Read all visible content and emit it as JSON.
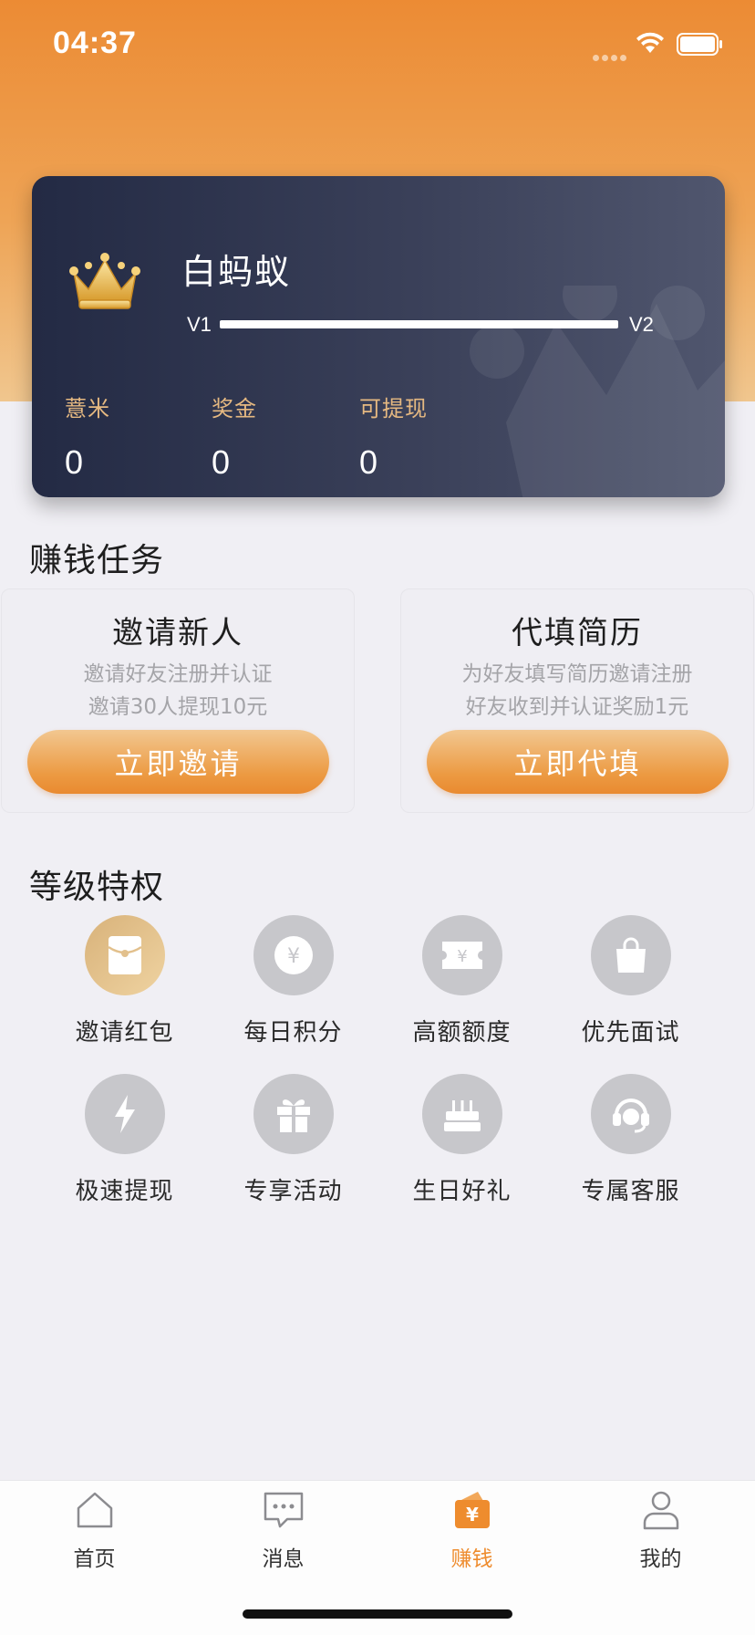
{
  "status_bar": {
    "time": "04:37"
  },
  "member_card": {
    "name": "白蚂蚁",
    "level_from": "V1",
    "level_to": "V2",
    "level_progress": 0,
    "stats": [
      {
        "label": "薏米",
        "value": "0"
      },
      {
        "label": "奖金",
        "value": "0"
      },
      {
        "label": "可提现",
        "value": "0"
      }
    ]
  },
  "tasks_section": {
    "title": "赚钱任务",
    "tasks": [
      {
        "title": "邀请新人",
        "desc1": "邀请好友注册并认证",
        "desc2": "邀请30人提现10元",
        "button": "立即邀请"
      },
      {
        "title": "代填简历",
        "desc1": "为好友填写简历邀请注册",
        "desc2": "好友收到并认证奖励1元",
        "button": "立即代填"
      }
    ]
  },
  "privileges_section": {
    "title": "等级特权",
    "items": [
      {
        "label": "邀请红包",
        "icon": "red-envelope-icon"
      },
      {
        "label": "每日积分",
        "icon": "yen-coin-icon"
      },
      {
        "label": "高额额度",
        "icon": "yen-ticket-icon"
      },
      {
        "label": "优先面试",
        "icon": "bag-icon"
      },
      {
        "label": "极速提现",
        "icon": "lightning-icon"
      },
      {
        "label": "专享活动",
        "icon": "gift-icon"
      },
      {
        "label": "生日好礼",
        "icon": "cake-icon"
      },
      {
        "label": "专属客服",
        "icon": "headset-icon"
      }
    ]
  },
  "tabbar": {
    "tabs": [
      {
        "label": "首页",
        "icon": "home-icon"
      },
      {
        "label": "消息",
        "icon": "message-icon"
      },
      {
        "label": "赚钱",
        "icon": "wallet-icon",
        "active": true
      },
      {
        "label": "我的",
        "icon": "profile-icon"
      }
    ]
  },
  "colors": {
    "accent": "#ee8c2e",
    "card_dark": "#232a44",
    "gold_text": "#e6b981"
  }
}
